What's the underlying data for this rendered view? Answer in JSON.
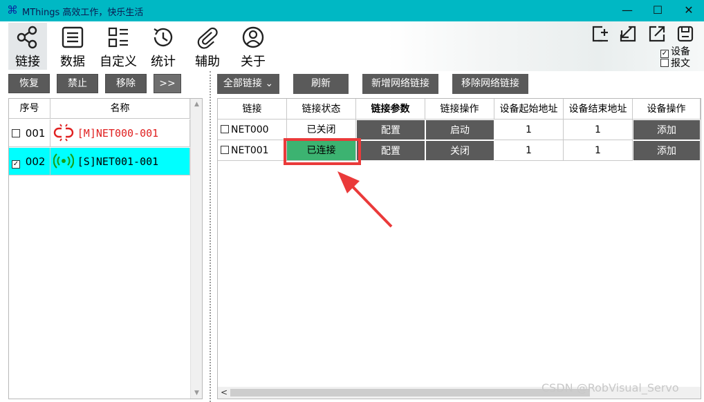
{
  "window": {
    "title": "MThings  高效工作，快乐生活",
    "minimize": "—",
    "maximize": "☐",
    "close": "✕"
  },
  "toolbar": {
    "tabs": [
      {
        "label": "链接",
        "icon": "share-icon"
      },
      {
        "label": "数据",
        "icon": "list-icon"
      },
      {
        "label": "自定义",
        "icon": "grid-list-icon"
      },
      {
        "label": "统计",
        "icon": "history-icon"
      },
      {
        "label": "辅助",
        "icon": "paperclip-icon"
      },
      {
        "label": "关于",
        "icon": "user-icon"
      }
    ],
    "right_icons": [
      "add-window-icon",
      "import-icon",
      "export-icon",
      "save-icon"
    ],
    "checks": [
      {
        "label": "设备",
        "checked": true
      },
      {
        "label": "报文",
        "checked": false
      }
    ]
  },
  "left_panel": {
    "buttons": [
      "恢复",
      "禁止",
      "移除",
      ">>"
    ],
    "columns": [
      "序号",
      "名称"
    ],
    "rows": [
      {
        "checked": false,
        "index": "001",
        "name": "[M]NET000-001",
        "state": "broken-link",
        "name_color": "#e02020"
      },
      {
        "checked": true,
        "index": "002",
        "name": "[S]NET001-001",
        "state": "signal",
        "name_color": "#000000"
      }
    ]
  },
  "right_panel": {
    "buttons": [
      "全部链接",
      "刷新",
      "新增网络链接",
      "移除网络链接"
    ],
    "dropdown_arrow": "⌄",
    "columns": [
      "链接",
      "链接状态",
      "链接参数",
      "链接操作",
      "设备起始地址",
      "设备结束地址",
      "设备操作"
    ],
    "rows": [
      {
        "checked": false,
        "link": "NET000",
        "status": "已关闭",
        "param": "配置",
        "op": "启动",
        "start": "1",
        "end": "1",
        "dev_op": "添加"
      },
      {
        "checked": false,
        "link": "NET001",
        "status": "已连接",
        "param": "配置",
        "op": "关闭",
        "start": "1",
        "end": "1",
        "dev_op": "添加"
      }
    ],
    "scroll_left": "<"
  },
  "annotation": {
    "color": "#ea3a3a"
  },
  "status_color_connected": "#3cb371",
  "watermark": "CSDN @RobVisual_Servo"
}
